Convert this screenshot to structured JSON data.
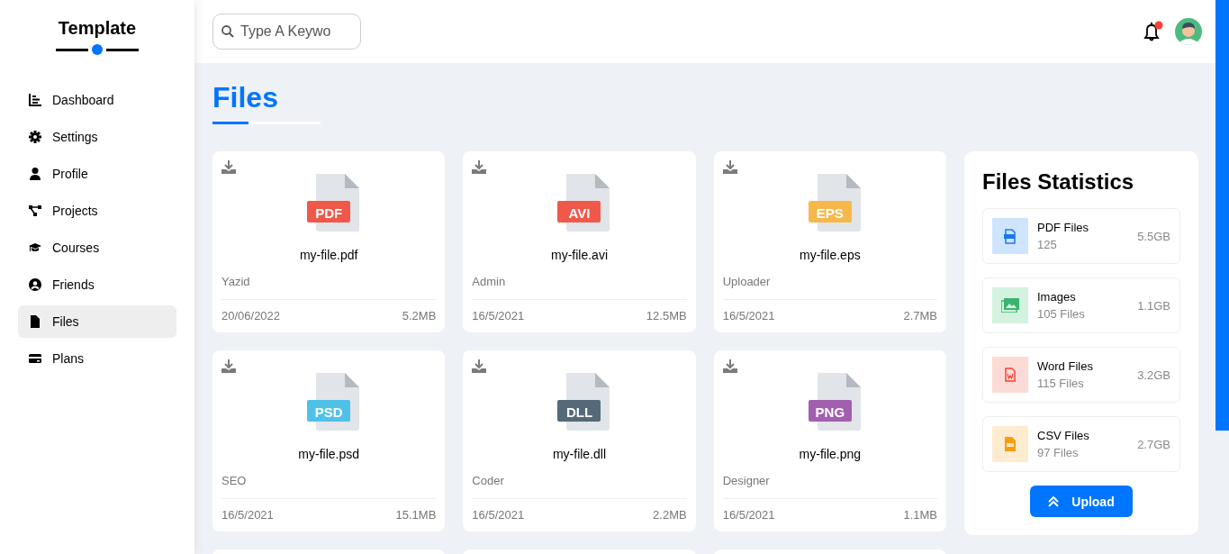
{
  "brand": "Template",
  "sidebar": {
    "items": [
      {
        "label": "Dashboard",
        "selected": false
      },
      {
        "label": "Settings",
        "selected": false
      },
      {
        "label": "Profile",
        "selected": false
      },
      {
        "label": "Projects",
        "selected": false
      },
      {
        "label": "Courses",
        "selected": false
      },
      {
        "label": "Friends",
        "selected": false
      },
      {
        "label": "Files",
        "selected": true
      },
      {
        "label": "Plans",
        "selected": false
      }
    ]
  },
  "search": {
    "placeholder": "Type A Keywo"
  },
  "notifications": {
    "unread": true
  },
  "page_title": "Files",
  "files": [
    {
      "kind": "card",
      "tag": "PDF",
      "color": "#f0594a",
      "name": "my-file.pdf",
      "uploader": "Yazid",
      "date": "20/06/2022",
      "size": "5.2MB"
    },
    {
      "kind": "card",
      "tag": "AVI",
      "color": "#f0594a",
      "name": "my-file.avi",
      "uploader": "Admin",
      "date": "16/5/2021",
      "size": "12.5MB"
    },
    {
      "kind": "card",
      "tag": "EPS",
      "color": "#f7b84b",
      "name": "my-file.eps",
      "uploader": "Uploader",
      "date": "16/5/2021",
      "size": "2.7MB"
    },
    {
      "kind": "card",
      "tag": "PSD",
      "color": "#4fc1e9",
      "name": "my-file.psd",
      "uploader": "SEO",
      "date": "16/5/2021",
      "size": "15.1MB"
    },
    {
      "kind": "card",
      "tag": "DLL",
      "color": "#546a79",
      "name": "my-file.dll",
      "uploader": "Coder",
      "date": "16/5/2021",
      "size": "2.2MB"
    },
    {
      "kind": "card",
      "tag": "PNG",
      "color": "#a15fae",
      "name": "my-file.png",
      "uploader": "Designer",
      "date": "16/5/2021",
      "size": "1.1MB"
    },
    {
      "kind": "cut"
    },
    {
      "kind": "cut"
    },
    {
      "kind": "cut"
    }
  ],
  "statistics": {
    "title": "Files Statistics",
    "items": [
      {
        "color": "#cfe4fd",
        "name": "PDF Files",
        "count": "125",
        "size": "5.5GB"
      },
      {
        "color": "#d3f3e0",
        "name": "Images",
        "count": "105 Files",
        "size": "1.1GB"
      },
      {
        "color": "#fcdad6",
        "name": "Word Files",
        "count": "115 Files",
        "size": "3.2GB"
      },
      {
        "color": "#fdecd0",
        "name": "CSV Files",
        "count": "97 Files",
        "size": "2.7GB"
      }
    ],
    "button": "Upload"
  }
}
